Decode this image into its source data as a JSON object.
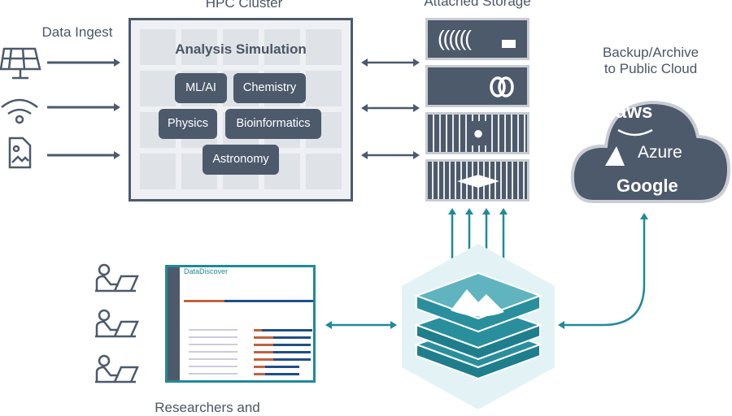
{
  "labels": {
    "hpc": "HPC Cluster",
    "storage": "Attached Storage",
    "ingest": "Data Ingest",
    "backup_line1": "Backup/Archive",
    "backup_line2": "to Public Cloud",
    "researchers": "Researchers and"
  },
  "hpc": {
    "title": "Analysis Simulation",
    "workloads": [
      "ML/AI",
      "Chemistry",
      "Physics",
      "Bioinformatics",
      "Astronomy"
    ]
  },
  "ingest_icons": [
    "solar-panel-icon",
    "wireless-icon",
    "image-file-icon"
  ],
  "storage_icons": [
    "storage-array-1",
    "storage-array-2-rings-logo",
    "storage-array-3-pure-logo",
    "storage-array-4-diamond-logo"
  ],
  "cloud": {
    "providers": [
      "aws",
      "Azure",
      "Google"
    ]
  },
  "app": {
    "title": "DataDiscover"
  },
  "colors": {
    "slate": "#4d5a6c",
    "teal": "#1f8a99",
    "orange": "#c0633f",
    "blue": "#1f4f86"
  }
}
